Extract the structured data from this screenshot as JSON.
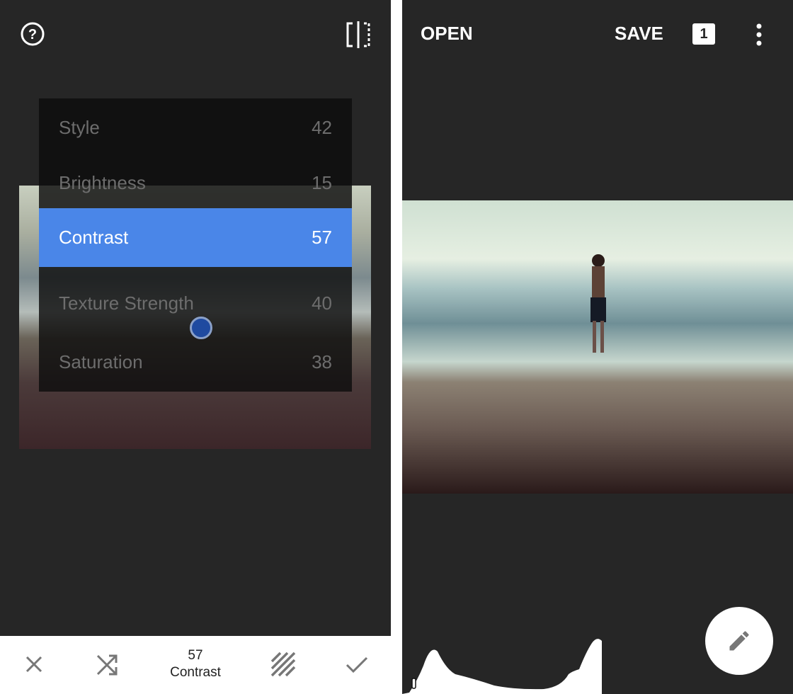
{
  "left_panel": {
    "menu": [
      {
        "label": "Style",
        "value": "42"
      },
      {
        "label": "Brightness",
        "value": "15"
      },
      {
        "label": "Contrast",
        "value": "57",
        "selected": true
      },
      {
        "label": "Texture Strength",
        "value": "40"
      },
      {
        "label": "Saturation",
        "value": "38"
      }
    ],
    "bottom": {
      "value": "57",
      "label": "Contrast"
    },
    "accent": "#4a86e8"
  },
  "right_panel": {
    "open_label": "OPEN",
    "save_label": "SAVE",
    "badge": "1"
  }
}
